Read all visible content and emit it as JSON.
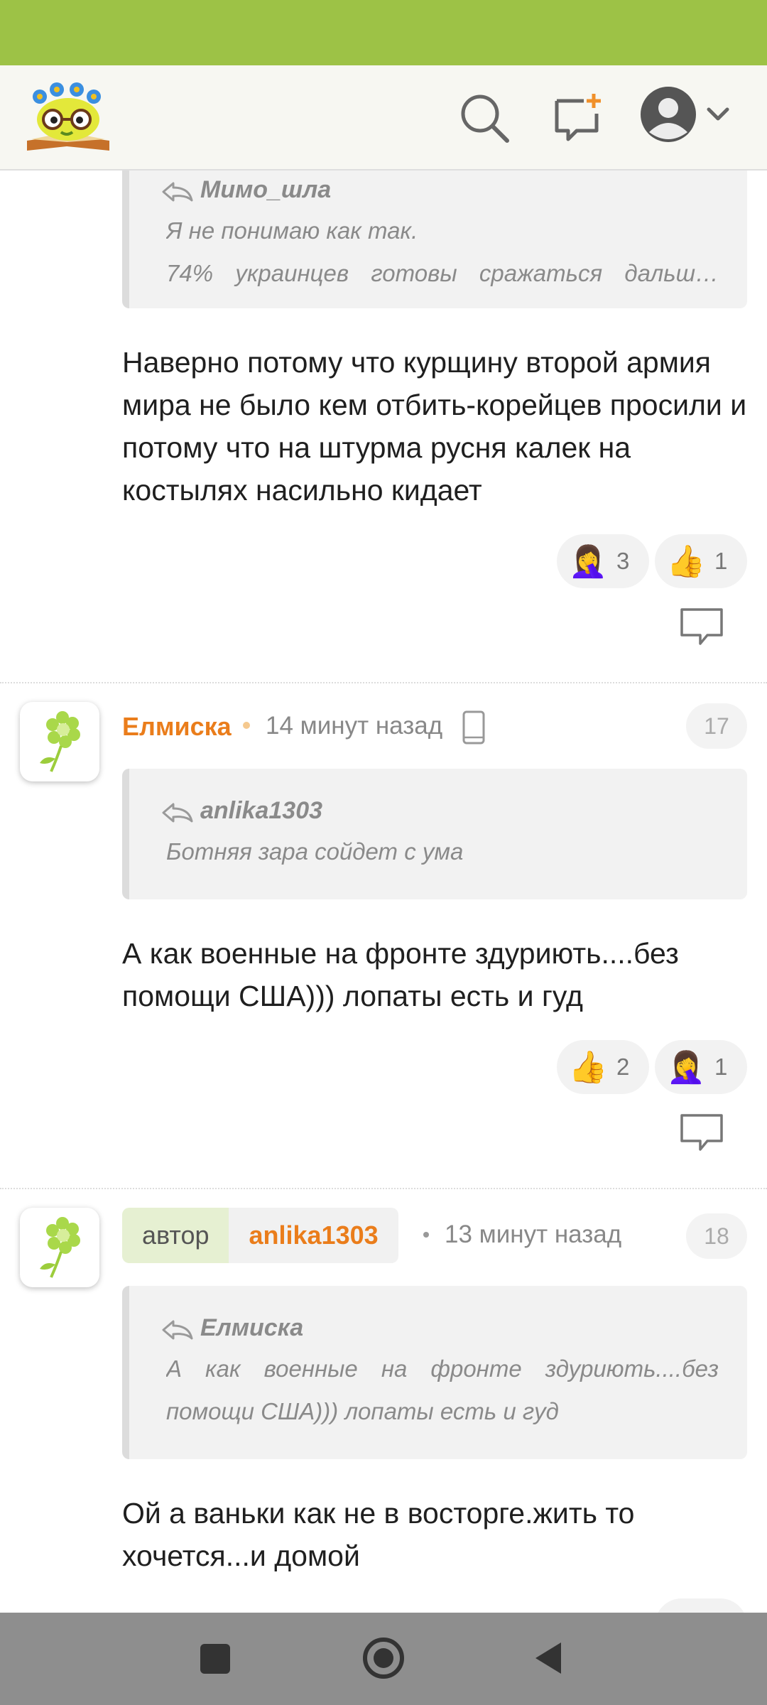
{
  "header": {
    "logo_icon": "book-with-glasses-logo",
    "search_icon": "search-icon",
    "new_post_icon": "new-message-icon",
    "profile_icon": "user-avatar-icon",
    "dropdown_icon": "chevron-down-icon"
  },
  "comments": [
    {
      "quote": {
        "author": "Мимо_шла",
        "lines": [
          "Я не понимаю как так.",
          "74% украинцев готовы сражаться дальш…"
        ]
      },
      "text": "Наверно потому что курщину второй армия мира не было кем отбить-корейцев просили и потому что на штурма русня калек на костылях насильно кидает",
      "reactions": [
        {
          "emoji": "🤦‍♀️",
          "count": "3"
        },
        {
          "emoji": "👍",
          "count": "1"
        }
      ]
    },
    {
      "username": "Елмиска",
      "time": "14 минут назад",
      "device_icon": "mobile-phone-icon",
      "number": "17",
      "quote": {
        "author": "anlika1303",
        "lines": [
          "Ботняя зара сойдет с ума"
        ]
      },
      "text": "А как военные на фронте здуриють....без помощи США))) лопаты есть и гуд",
      "reactions": [
        {
          "emoji": "👍",
          "count": "2"
        },
        {
          "emoji": "🤦‍♀️",
          "count": "1"
        }
      ]
    },
    {
      "author_label": "автор",
      "username": "anlika1303",
      "time": "13 минут назад",
      "number": "18",
      "quote": {
        "author": "Елмиска",
        "lines": [
          "А как военные на фронте здуриють....без",
          "помощи США))) лопаты есть и гуд"
        ]
      },
      "text": "Ой а ваньки как не в восторге.жить то хочется...и домой"
    }
  ],
  "colors": {
    "status_bar": "#9dc246",
    "username": "#ea7d1b",
    "author_tag": "#e6f0d2"
  },
  "navbar": {
    "recents_icon": "square-recents-icon",
    "home_icon": "circle-home-icon",
    "back_icon": "triangle-back-icon"
  }
}
